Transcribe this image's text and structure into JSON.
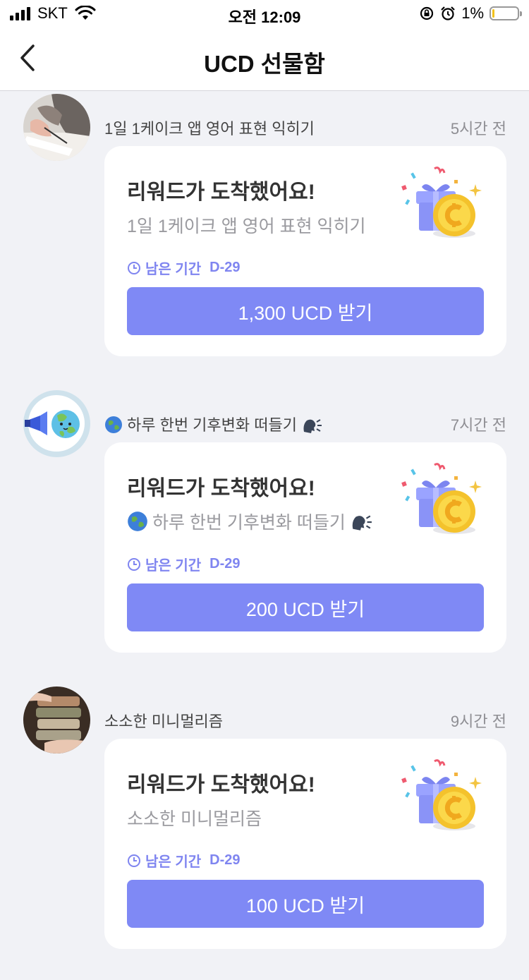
{
  "status_bar": {
    "carrier": "SKT",
    "time": "오전 12:09",
    "battery_text": "1%",
    "battery_level": 0.01
  },
  "nav": {
    "title": "UCD 선물함",
    "back_icon": "chevron-left-icon"
  },
  "items": [
    {
      "title": "1일 1케이크 앱 영어 표현 익히기",
      "time_ago": "5시간 전",
      "heading": "리워드가 도착했어요!",
      "subtitle": "1일 1케이크 앱 영어 표현 익히기",
      "deadline_label": "남은 기간",
      "deadline_value": "D-29",
      "cta": "1,300 UCD 받기"
    },
    {
      "title": "하루 한번 기후변화 떠들기",
      "time_ago": "7시간 전",
      "heading": "리워드가 도착했어요!",
      "subtitle": "하루 한번 기후변화 떠들기",
      "deadline_label": "남은 기간",
      "deadline_value": "D-29",
      "cta": "200 UCD 받기"
    },
    {
      "title": "소소한 미니멀리즘",
      "time_ago": "9시간 전",
      "heading": "리워드가 도착했어요!",
      "subtitle": "소소한 미니멀리즘",
      "deadline_label": "남은 기간",
      "deadline_value": "D-29",
      "cta": "100 UCD 받기"
    }
  ],
  "colors": {
    "accent": "#7f89f5",
    "deadline": "#7f85f0",
    "background": "#f1f2f6"
  }
}
